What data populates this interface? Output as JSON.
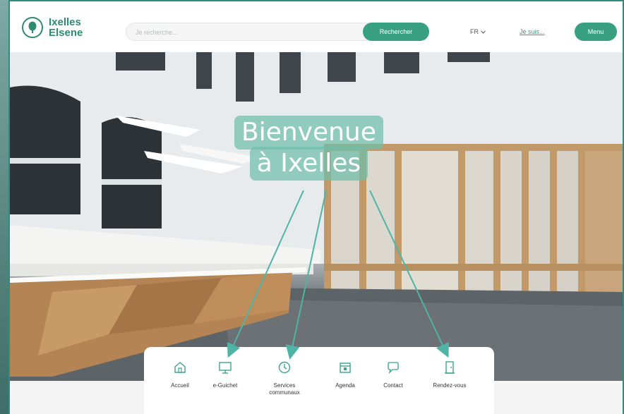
{
  "header": {
    "logo_line1": "Ixelles",
    "logo_line2": "Elsene",
    "search_placeholder": "Je recherche...",
    "search_button": "Rechercher",
    "language": "FR",
    "account_link": "Je suis...",
    "menu_button": "Menu"
  },
  "hero": {
    "title_line1": "Bienvenue",
    "title_line2": "à Ixelles"
  },
  "quicknav": {
    "items": [
      {
        "label": "Accueil",
        "icon": "home-icon"
      },
      {
        "label": "e-Guichet",
        "icon": "monitor-icon"
      },
      {
        "label": "Services communaux",
        "icon": "clock-icon"
      },
      {
        "label": "Agenda",
        "icon": "calendar-icon"
      },
      {
        "label": "Contact",
        "icon": "chat-icon"
      },
      {
        "label": "Rendez-vous",
        "icon": "door-icon"
      }
    ]
  },
  "colors": {
    "brand": "#2e8b72",
    "button": "#39a07f",
    "annotation": "#4fb3a6"
  }
}
